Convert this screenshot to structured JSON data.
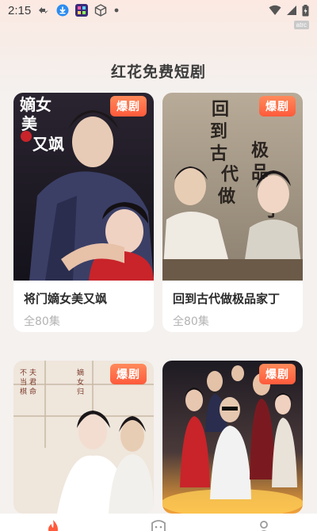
{
  "status_bar": {
    "time": "2:15",
    "small_badge": "atrc"
  },
  "page": {
    "title": "红花免费短剧"
  },
  "cards": [
    {
      "tag": "爆剧",
      "title": "将门嫡女美又飒",
      "episodes": "全80集",
      "poster_text": "嫡女美又飒"
    },
    {
      "tag": "爆剧",
      "title": "回到古代做极品家丁",
      "episodes": "全80集",
      "poster_text": "回到古代做极品家丁"
    },
    {
      "tag": "爆剧",
      "title": "",
      "episodes": "",
      "poster_text": ""
    },
    {
      "tag": "爆剧",
      "title": "",
      "episodes": "",
      "poster_text": ""
    }
  ],
  "bottom_nav": {
    "items": [
      {
        "icon": "home-flame-icon",
        "active": true
      },
      {
        "icon": "theater-icon",
        "active": false
      },
      {
        "icon": "profile-icon",
        "active": false
      }
    ]
  },
  "colors": {
    "accent": "#ff5a3b",
    "tag_gradient_top": "#ff8a5b",
    "title_text": "#2b2b2b",
    "muted_text": "#b3b3b3",
    "background": "#f4f1ef"
  }
}
